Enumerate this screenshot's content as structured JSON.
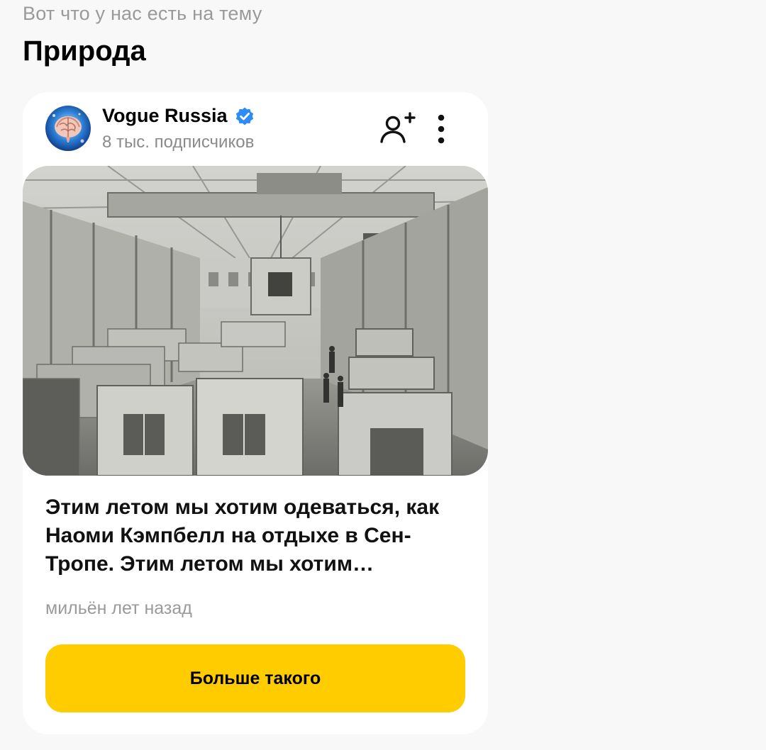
{
  "header": {
    "subtitle": "Вот что у  нас  есть на тему",
    "title": "Природа"
  },
  "card": {
    "channel": {
      "name": "Vogue Russia",
      "subscribers": "8 тыс. подписчиков",
      "verified": true,
      "verified_color": "#2f8cf6"
    },
    "icons": {
      "subscribe": "add-user-icon",
      "more": "vertical-dots-icon",
      "verified": "verified-check-icon"
    },
    "article": {
      "title": "Этим летом мы хотим одеваться, как Наоми Кэмпбелл на отдыхе в Сен-Тропе. Этим летом мы хотим одеваться, как Наоми Кэмпбелл на отдыхе в Сен-Тропе.",
      "time": "мильён лет назад"
    },
    "button_label": "Больше такого"
  },
  "colors": {
    "background": "#f8f8f8",
    "card": "#ffffff",
    "accent": "#ffcc00",
    "muted_text": "#9a9a9a"
  }
}
